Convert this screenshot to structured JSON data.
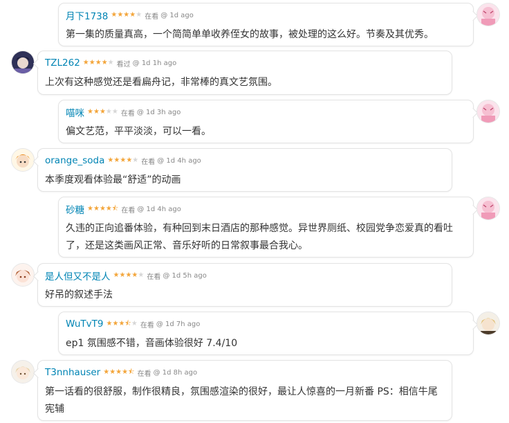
{
  "comments": [
    {
      "user": "月下1738",
      "rating": 4,
      "status": "在看",
      "time": "@ 1d ago",
      "text": "第一集的质量真高，一个简简单单收养侄女的故事，被处理的这么好。节奏及其优秀。",
      "avatar": "pink-avatar"
    },
    {
      "user": "TZL262",
      "rating": 4,
      "status": "看过",
      "time": "@ 1d 1h ago",
      "text": "上次有这种感觉还是看扁舟记，非常棒的真文艺氛围。",
      "avatar": "dark-anime-avatar"
    },
    {
      "user": "喵咪",
      "rating": 3,
      "status": "在看",
      "time": "@ 1d 3h ago",
      "text": "偏文艺范，平平淡淡，可以一看。",
      "avatar": "pink-avatar"
    },
    {
      "user": "orange_soda",
      "rating": 4,
      "status": "在看",
      "time": "@ 1d 4h ago",
      "text": "本季度观看体验最“舒适”的动画",
      "avatar": "orange-hair-avatar"
    },
    {
      "user": "砂糖",
      "rating": 4.5,
      "status": "在看",
      "time": "@ 1d 4h ago",
      "text": "久违的正向追番体验，有种回到末日酒店的那种感觉。异世界厕纸、校园党争恋爱真的看吐了，还是这类画风正常、音乐好听的日常叙事最合我心。",
      "avatar": "pink-avatar"
    },
    {
      "user": "是人但又不是人",
      "rating": 4,
      "status": "在看",
      "time": "@ 1d 5h ago",
      "text": "好吊的叙述手法",
      "avatar": "brown-hair-avatar"
    },
    {
      "user": "WuTvT9",
      "rating": 3.5,
      "status": "在看",
      "time": "@ 1d 7h ago",
      "text": "ep1 氛围感不错，音画体验很好 7.4/10",
      "avatar": "blonde-hair-avatar"
    },
    {
      "user": "T3nnhauser",
      "rating": 4.5,
      "status": "在看",
      "time": "@ 1d 8h ago",
      "text": "第一话看的很舒服，制作很精良，氛围感渲染的很好，最让人惊喜的一月新番 PS：相信牛尾宪辅",
      "avatar": "light-hair-avatar"
    }
  ],
  "colors": {
    "username": "#0084b4",
    "star": "#f3a53a",
    "star_off": "#d6d6d6",
    "meta": "#888888",
    "text": "#333333",
    "border": "#e3e3e3"
  }
}
